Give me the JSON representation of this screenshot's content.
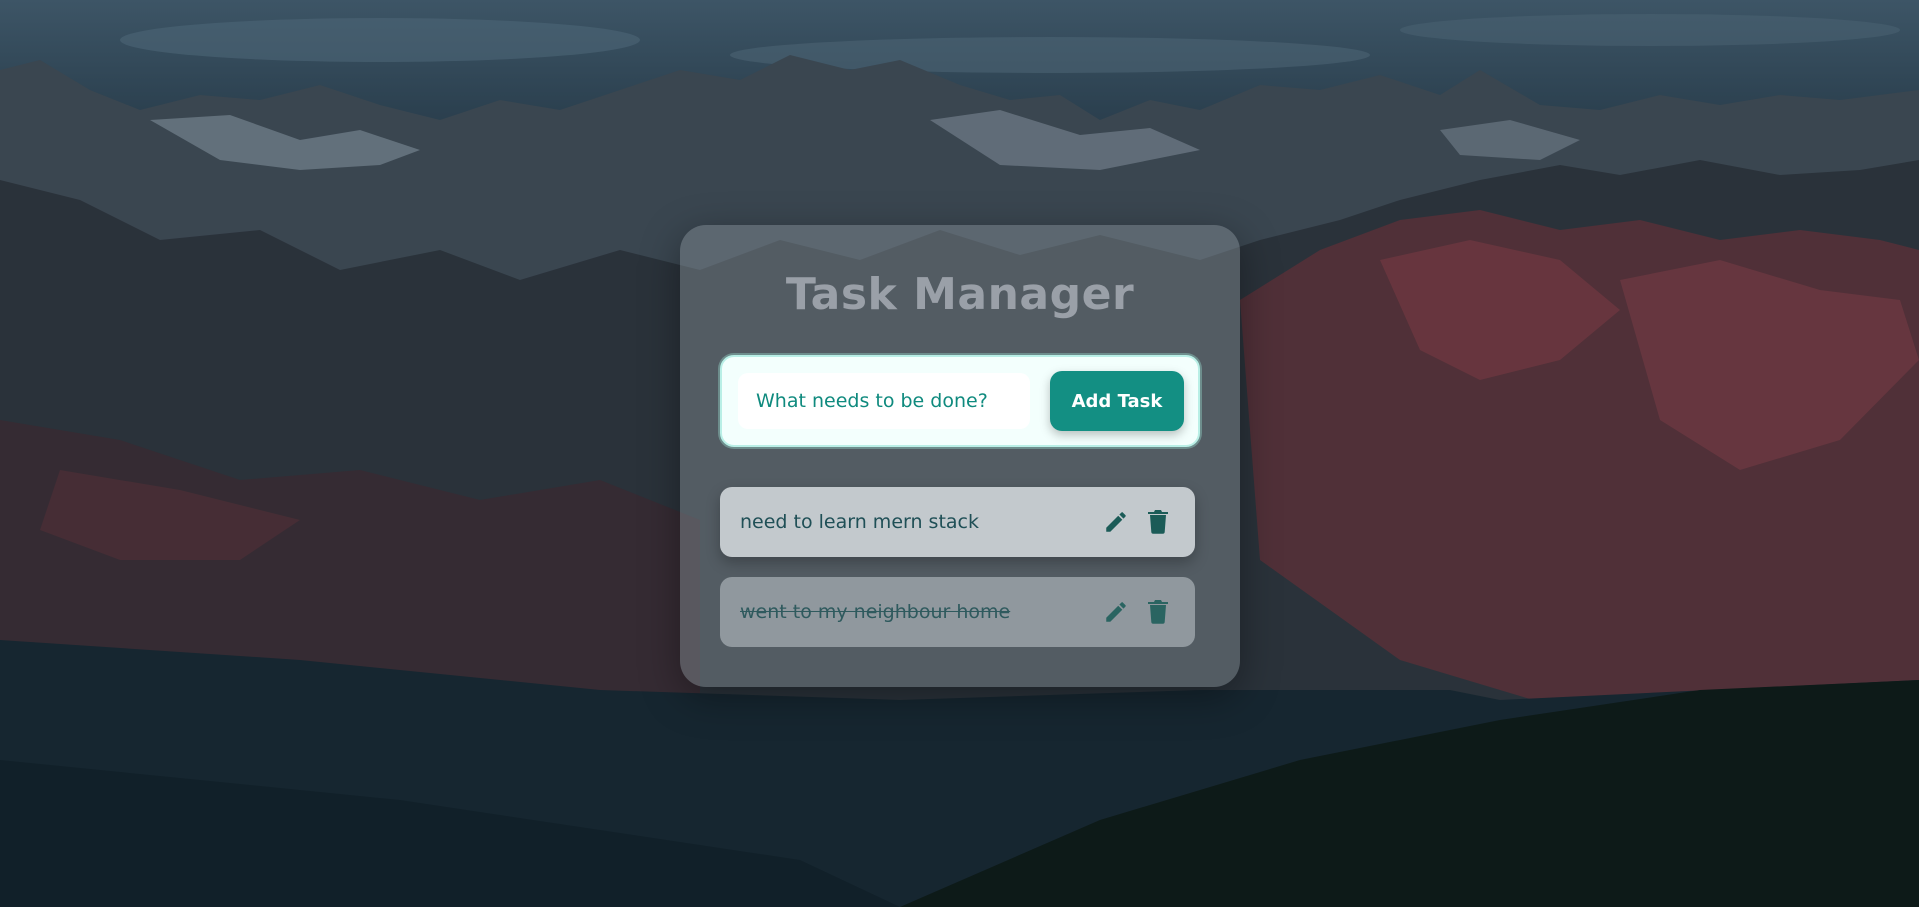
{
  "app": {
    "title": "Task Manager"
  },
  "add_form": {
    "input_placeholder": "What needs to be done?",
    "input_value": "",
    "add_button_label": "Add Task"
  },
  "tasks": [
    {
      "text": "need to learn mern stack",
      "completed": false,
      "edit_icon": "pencil-icon",
      "delete_icon": "trash-icon"
    },
    {
      "text": "went to my neighbour home",
      "completed": true,
      "edit_icon": "pencil-icon",
      "delete_icon": "trash-icon"
    }
  ],
  "colors": {
    "accent": "#138f83",
    "task_text": "#1f4f56",
    "input_text": "#0f8a7e"
  }
}
